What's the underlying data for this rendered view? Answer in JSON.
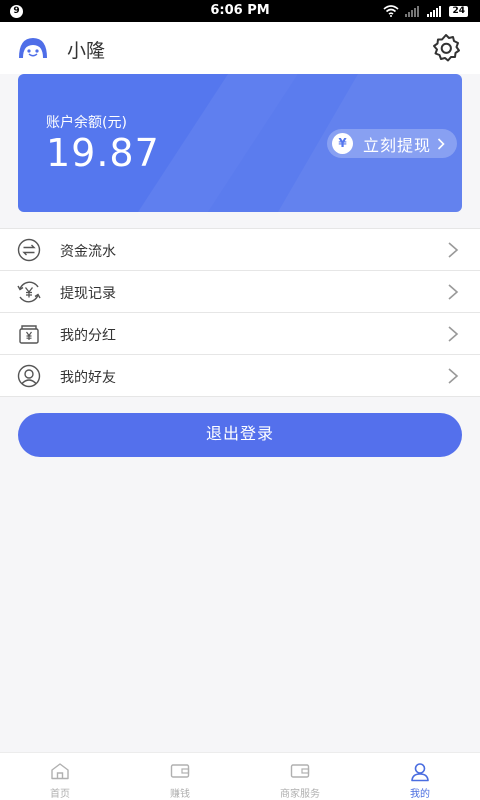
{
  "status_bar": {
    "notification_badge": "9",
    "time": "6:06 PM",
    "battery": "24"
  },
  "header": {
    "username": "小隆",
    "settings_icon": "gear-icon"
  },
  "balance_card": {
    "label": "账户余额(元)",
    "amount": "19.87",
    "withdraw_button": "立刻提现",
    "currency_symbol": "¥",
    "colors": {
      "card": "#5577ee"
    }
  },
  "menu": {
    "items": [
      {
        "label": "资金流水",
        "icon": "exchange-icon"
      },
      {
        "label": "提现记录",
        "icon": "yen-cycle-icon"
      },
      {
        "label": "我的分红",
        "icon": "wallet-yen-icon"
      },
      {
        "label": "我的好友",
        "icon": "user-icon"
      }
    ]
  },
  "logout_button": "退出登录",
  "tabs": [
    {
      "label": "首页",
      "icon": "home-icon",
      "active": false
    },
    {
      "label": "赚钱",
      "icon": "wallet-icon",
      "active": false
    },
    {
      "label": "商家服务",
      "icon": "wallet-icon",
      "active": false
    },
    {
      "label": "我的",
      "icon": "user-icon",
      "active": true
    }
  ],
  "colors": {
    "primary": "#5470ec",
    "tab_active": "#4a6de0"
  }
}
